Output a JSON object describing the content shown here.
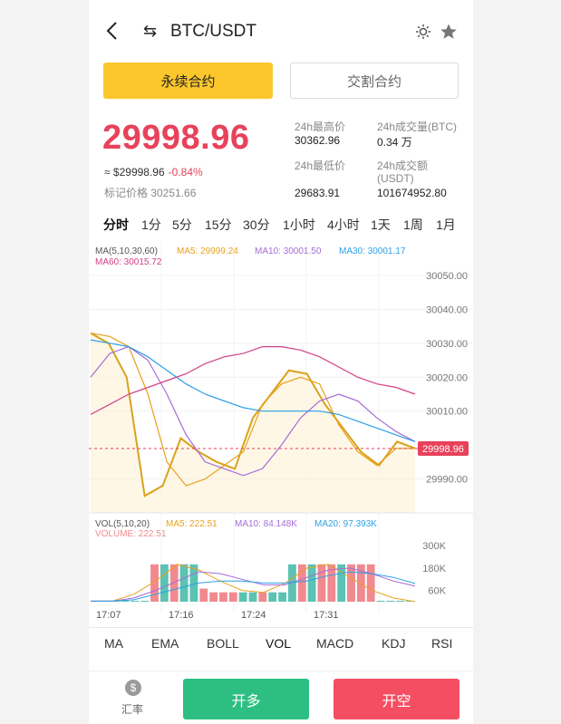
{
  "header": {
    "pair": "BTC/USDT",
    "back_icon": "chevron-left-icon",
    "swap_icon": "swap-arrows-icon",
    "theme_icon": "sun-icon",
    "favorite_icon": "star-icon"
  },
  "tabs": {
    "perpetual": "永续合约",
    "delivery": "交割合约"
  },
  "ticker": {
    "price": "29998.96",
    "usd_prefix": "≈ $29998.96",
    "change": "-0.84%",
    "mark_price": "标记价格 30251.66"
  },
  "stats": {
    "high_label": "24h最高价",
    "high_value": "30362.96",
    "vol_label": "24h成交量(BTC)",
    "vol_value": "0.34 万",
    "low_label": "24h最低价",
    "low_value": "29683.91",
    "amount_label": "24h成交额",
    "amount_label2": "(USDT)",
    "amount_value": "101674952.80"
  },
  "timeframes": [
    "分时",
    "1分",
    "5分",
    "15分",
    "30分",
    "1小时",
    "4小时",
    "1天",
    "1周",
    "1月"
  ],
  "chart_legend": {
    "ma_title": "MA(5,10,30,60)",
    "ma5": "MA5: 29999.24",
    "ma10": "MA10: 30001.50",
    "ma30": "MA30: 30001.17",
    "ma60": "MA60: 30015.72",
    "vol_title": "VOL(5,10,20)",
    "vol_ma5": "MA5: 222.51",
    "vol_ma10": "MA10: 84.148K",
    "vol_ma20": "MA20: 97.393K",
    "volume": "VOLUME: 222.51",
    "current_price_tag": "29998.96"
  },
  "colors": {
    "accent_yellow": "#fcc72d",
    "down_red": "#e8425b",
    "up_green": "#2dbe82",
    "ma5": "#e8a21e",
    "ma10": "#a56cd6",
    "ma30": "#2d9fe6",
    "ma60": "#d43e86",
    "vol_up": "#5cc2b3",
    "vol_down": "#f08a8f"
  },
  "chart_data": {
    "type": "line",
    "price_axis": {
      "ticks": [
        "30050.00",
        "30040.00",
        "30030.00",
        "30020.00",
        "30010.00",
        "29990.00"
      ],
      "tick_values": [
        30050,
        30040,
        30030,
        30020,
        30010,
        29990
      ],
      "ylim": [
        29980,
        30058
      ]
    },
    "time_labels": [
      "17:07",
      "17:16",
      "17:24",
      "17:31"
    ],
    "series": [
      {
        "name": "MA5",
        "color": "#e8a21e",
        "values": [
          30033,
          30032,
          30029,
          30015,
          29995,
          29988,
          29990,
          29994,
          29998,
          30012,
          30018,
          30020,
          30018,
          30006,
          29998,
          29994,
          29999,
          29999
        ]
      },
      {
        "name": "MA10",
        "color": "#a56cd6",
        "values": [
          30020,
          30027,
          30029,
          30025,
          30015,
          30003,
          29995,
          29993,
          29991,
          29993,
          30000,
          30008,
          30013,
          30015,
          30013,
          30008,
          30004,
          30001
        ]
      },
      {
        "name": "MA30",
        "color": "#2d9fe6",
        "values": [
          30031,
          30030,
          30029,
          30026,
          30022,
          30018,
          30015,
          30013,
          30011,
          30010,
          30010,
          30010,
          30010,
          30009,
          30007,
          30005,
          30003,
          30001
        ]
      },
      {
        "name": "MA60",
        "color": "#d43e86",
        "values": [
          30009,
          30012,
          30015,
          30017,
          30019,
          30021,
          30024,
          30026,
          30027,
          30029,
          30029,
          30028,
          30026,
          30023,
          30020,
          30018,
          30017,
          30015
        ]
      }
    ],
    "price_line": [
      30033,
      30030,
      30020,
      29985,
      29988,
      30002,
      29998,
      29995,
      29993,
      30008,
      30015,
      30022,
      30021,
      30012,
      30005,
      29998,
      29994,
      30001,
      29999
    ],
    "volume_axis": {
      "ticks": [
        "300K",
        "180K",
        "60K"
      ],
      "tick_values": [
        300000,
        180000,
        60000
      ],
      "ylim": [
        0,
        330000
      ]
    },
    "volume": {
      "values": [
        3000,
        3000,
        3000,
        3000,
        3000,
        3000,
        200000,
        200000,
        200000,
        200000,
        200000,
        70000,
        50000,
        50000,
        50000,
        50000,
        50000,
        50000,
        50000,
        50000,
        200000,
        200000,
        200000,
        200000,
        200000,
        200000,
        200000,
        200000,
        200000,
        3000,
        3000,
        3000,
        3000
      ],
      "up": [
        true,
        true,
        true,
        true,
        true,
        true,
        false,
        true,
        false,
        true,
        true,
        false,
        false,
        false,
        false,
        true,
        true,
        false,
        true,
        true,
        true,
        false,
        true,
        false,
        false,
        true,
        false,
        false,
        false,
        true,
        true,
        true,
        true
      ]
    },
    "volume_ma": [
      {
        "name": "MA5",
        "color": "#e8a21e",
        "values": [
          3000,
          3000,
          40000,
          110000,
          200000,
          170000,
          110000,
          60000,
          50000,
          100000,
          180000,
          200000,
          130000,
          60000,
          20000,
          222
        ]
      },
      {
        "name": "MA10",
        "color": "#a56cd6",
        "values": [
          3000,
          3000,
          20000,
          60000,
          110000,
          160000,
          150000,
          120000,
          90000,
          90000,
          130000,
          170000,
          180000,
          150000,
          110000,
          84148
        ]
      },
      {
        "name": "MA20",
        "color": "#2d9fe6",
        "values": [
          3000,
          3000,
          10000,
          40000,
          70000,
          100000,
          110000,
          110000,
          100000,
          100000,
          110000,
          140000,
          160000,
          150000,
          130000,
          97393
        ]
      }
    ]
  },
  "indicators": [
    "MA",
    "EMA",
    "BOLL",
    "VOL",
    "MACD",
    "KDJ",
    "RSI"
  ],
  "footer": {
    "rate_label": "汇率",
    "rate_icon": "dollar-circle-icon",
    "long_button": "开多",
    "short_button": "开空"
  }
}
